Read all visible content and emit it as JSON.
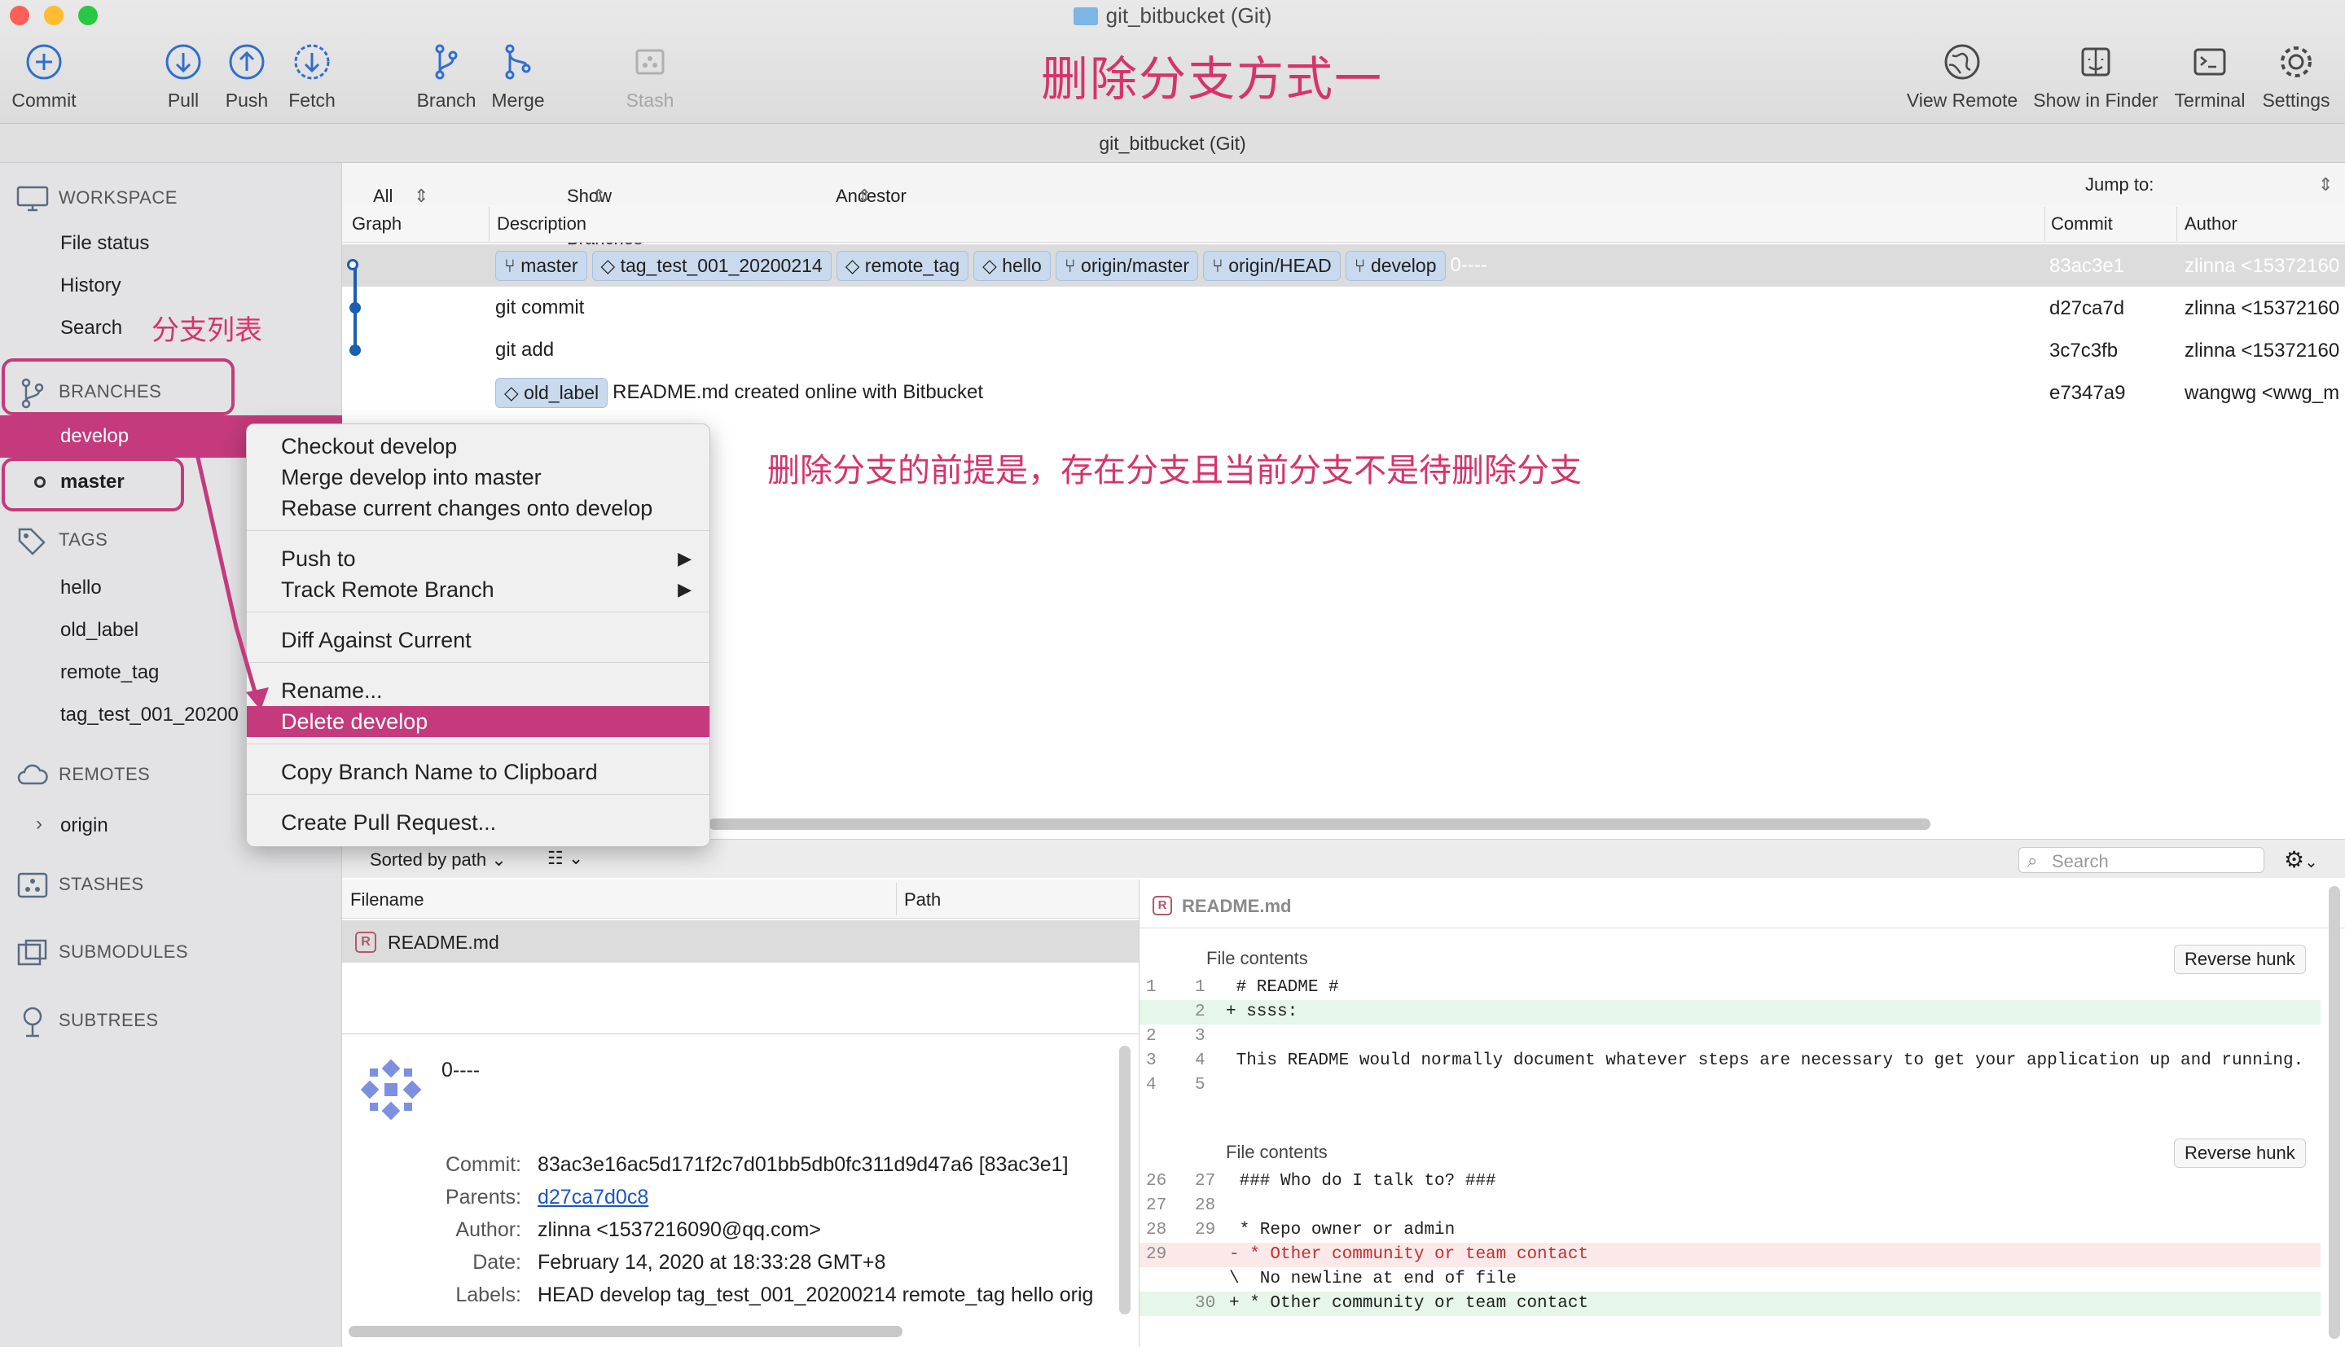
{
  "window": {
    "title": "git_bitbucket (Git)",
    "subtitle": "git_bitbucket (Git)"
  },
  "toolbar": {
    "commit": "Commit",
    "pull": "Pull",
    "push": "Push",
    "fetch": "Fetch",
    "branch": "Branch",
    "merge": "Merge",
    "stash": "Stash",
    "view_remote": "View Remote",
    "show_in_finder": "Show in Finder",
    "terminal": "Terminal",
    "settings": "Settings"
  },
  "annotations": {
    "title": "删除分支方式一",
    "branch_list": "分支列表",
    "note": "删除分支的前提是，存在分支且当前分支不是待删除分支"
  },
  "sidebar": {
    "workspace": "WORKSPACE",
    "file_status": "File status",
    "history": "History",
    "search": "Search",
    "branches": "BRANCHES",
    "branch_develop": "develop",
    "branch_master": "master",
    "tags": "TAGS",
    "tag_hello": "hello",
    "tag_old_label": "old_label",
    "tag_remote_tag": "remote_tag",
    "tag_test": "tag_test_001_20200",
    "remotes": "REMOTES",
    "remote_origin": "origin",
    "stashes": "STASHES",
    "submodules": "SUBMODULES",
    "subtrees": "SUBTREES"
  },
  "filters": {
    "branches": "All Branches",
    "remote": "Show Remote Branches",
    "order": "Ancestor Order",
    "jump": "Jump to:"
  },
  "columns": {
    "graph": "Graph",
    "description": "Description",
    "commit": "Commit",
    "author": "Author"
  },
  "commits": [
    {
      "labels": [
        "master",
        "tag_test_001_20200214",
        "remote_tag",
        "hello",
        "origin/master",
        "origin/HEAD",
        "develop"
      ],
      "message": "0----",
      "hash": "83ac3e1",
      "author": "zlinna <15372160"
    },
    {
      "message": "git commit",
      "hash": "d27ca7d",
      "author": "zlinna <15372160"
    },
    {
      "message": "git add",
      "hash": "3c7c3fb",
      "author": "zlinna <15372160"
    },
    {
      "labels": [
        "old_label"
      ],
      "message": "README.md created online with Bitbucket",
      "hash": "e7347a9",
      "author": "wangwg <wwg_m"
    }
  ],
  "context_menu": {
    "checkout": "Checkout develop",
    "merge": "Merge develop into master",
    "rebase": "Rebase current changes onto develop",
    "push_to": "Push to",
    "track": "Track Remote Branch",
    "diff": "Diff Against Current",
    "rename": "Rename...",
    "delete": "Delete develop",
    "copy": "Copy Branch Name to Clipboard",
    "pull_request": "Create Pull Request..."
  },
  "files": {
    "sort": "Sorted by path",
    "search_placeholder": "Search",
    "col_filename": "Filename",
    "col_path": "Path",
    "file": "README.md"
  },
  "commit_info": {
    "summary": "0----",
    "commit_label": "Commit:",
    "commit": "83ac3e16ac5d171f2c7d01bb5db0fc311d9d47a6 [83ac3e1]",
    "parents_label": "Parents:",
    "parents": "d27ca7d0c8",
    "author_label": "Author:",
    "author": "zlinna <1537216090@qq.com>",
    "date_label": "Date:",
    "date": "February 14, 2020 at 18:33:28 GMT+8",
    "labels_label": "Labels:",
    "labels": "HEAD develop tag_test_001_20200214 remote_tag hello orig"
  },
  "diff": {
    "file": "README.md",
    "hunk_title": "File contents",
    "reverse": "Reverse hunk",
    "hunk1": [
      {
        "o": "1",
        "n": "1",
        "t": " # README #",
        "k": "ctx"
      },
      {
        "o": "",
        "n": "2",
        "t": "+ ssss:",
        "k": "add"
      },
      {
        "o": "2",
        "n": "3",
        "t": "",
        "k": "ctx"
      },
      {
        "o": "3",
        "n": "4",
        "t": " This README would normally document whatever steps are necessary to get your application up and running.",
        "k": "ctx"
      },
      {
        "o": "4",
        "n": "5",
        "t": "",
        "k": "ctx"
      }
    ],
    "hunk2": [
      {
        "o": "26",
        "n": "27",
        "t": " ### Who do I talk to? ###",
        "k": "ctx"
      },
      {
        "o": "27",
        "n": "28",
        "t": "",
        "k": "ctx"
      },
      {
        "o": "28",
        "n": "29",
        "t": " * Repo owner or admin",
        "k": "ctx"
      },
      {
        "o": "29",
        "n": "",
        "t": "- * Other community or team contact",
        "k": "del"
      },
      {
        "o": "",
        "n": "",
        "t": "\\  No newline at end of file",
        "k": "ctx"
      },
      {
        "o": "",
        "n": "30",
        "t": "+ * Other community or team contact",
        "k": "add"
      }
    ]
  },
  "colors": {
    "accent": "#c43a7c",
    "annotation": "#d6336c",
    "graph": "#1a5fb4",
    "tag_bg": "#c9d9ee"
  }
}
